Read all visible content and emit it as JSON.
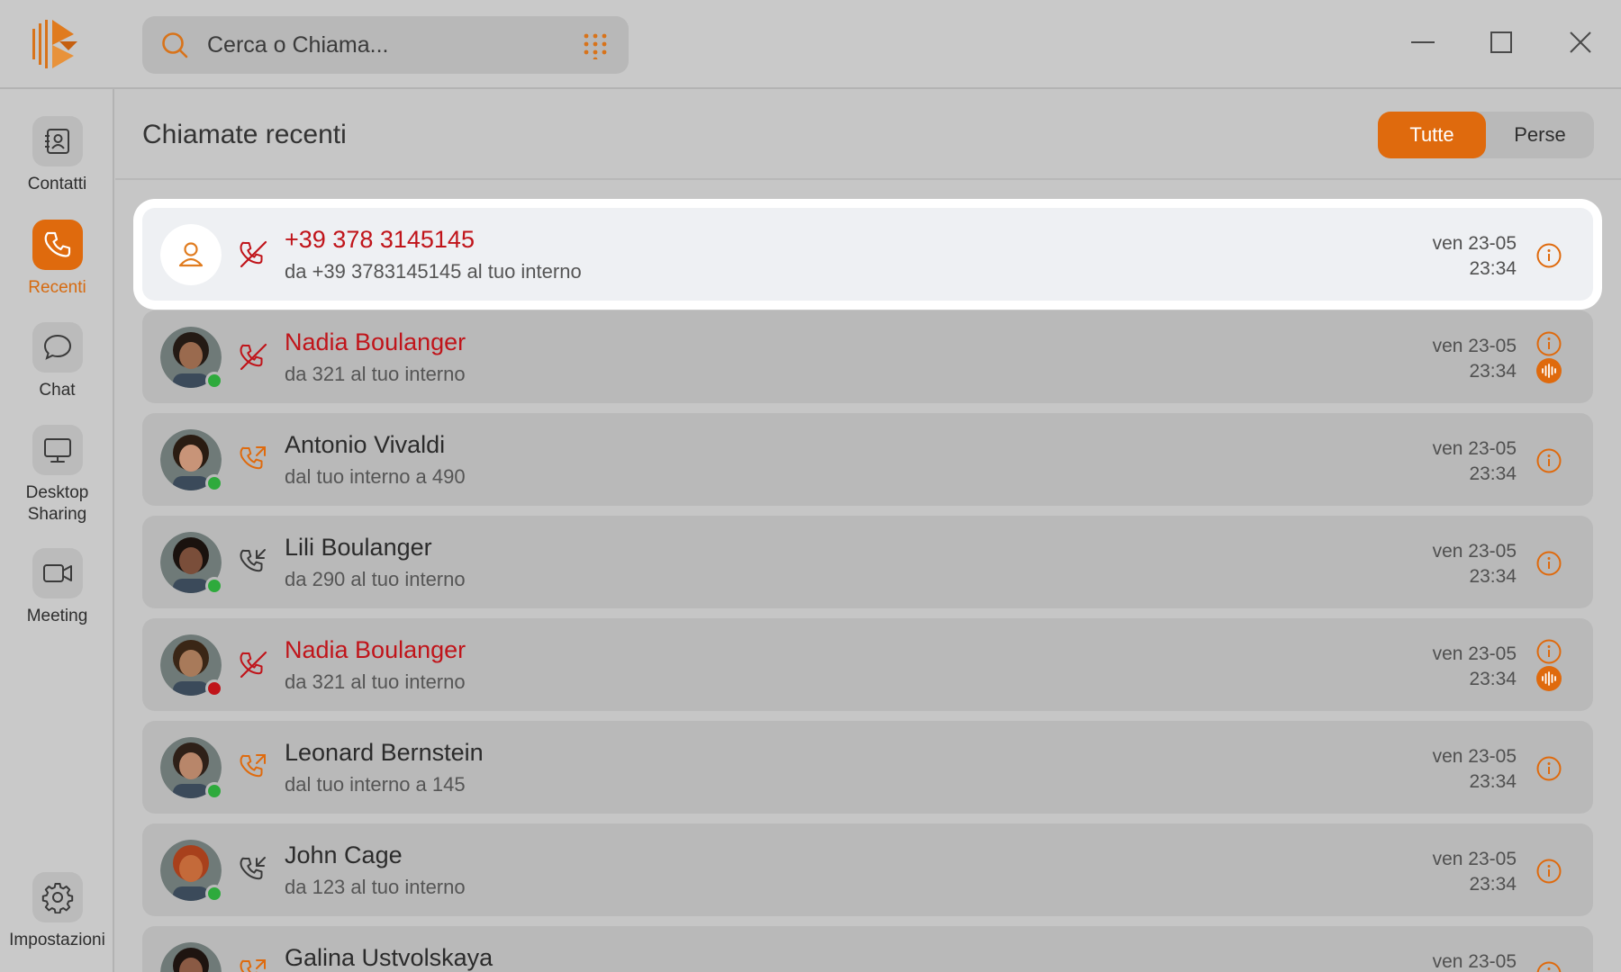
{
  "search": {
    "placeholder": "Cerca o Chiama..."
  },
  "sidebar": {
    "items": [
      {
        "label": "Contatti"
      },
      {
        "label": "Recenti"
      },
      {
        "label": "Chat"
      },
      {
        "label": "Desktop\nSharing"
      },
      {
        "label": "Meeting"
      },
      {
        "label": "Impostazioni"
      }
    ]
  },
  "main": {
    "title": "Chiamate recenti",
    "filter": {
      "all": "Tutte",
      "missed": "Perse",
      "selected": "Tutte"
    }
  },
  "calls": [
    {
      "name": "+39 378 3145145",
      "detail": "da +39 3783145145 al tuo interno",
      "date": "ven 23-05",
      "time": "23:34",
      "type": "missed",
      "status": "",
      "recording": false,
      "selected": true
    },
    {
      "name": "Nadia Boulanger",
      "detail": "da 321 al tuo interno",
      "date": "ven 23-05",
      "time": "23:34",
      "type": "missed",
      "status": "online",
      "recording": true,
      "selected": false
    },
    {
      "name": "Antonio Vivaldi",
      "detail": "dal tuo interno a 490",
      "date": "ven 23-05",
      "time": "23:34",
      "type": "outgoing",
      "status": "online",
      "recording": false,
      "selected": false
    },
    {
      "name": "Lili Boulanger",
      "detail": "da 290 al tuo interno",
      "date": "ven 23-05",
      "time": "23:34",
      "type": "incoming",
      "status": "online",
      "recording": false,
      "selected": false
    },
    {
      "name": "Nadia Boulanger",
      "detail": "da 321 al tuo interno",
      "date": "ven 23-05",
      "time": "23:34",
      "type": "missed",
      "status": "busy",
      "recording": true,
      "selected": false
    },
    {
      "name": "Leonard Bernstein",
      "detail": "dal tuo interno a 145",
      "date": "ven 23-05",
      "time": "23:34",
      "type": "outgoing",
      "status": "online",
      "recording": false,
      "selected": false
    },
    {
      "name": "John Cage",
      "detail": "da 123 al tuo interno",
      "date": "ven 23-05",
      "time": "23:34",
      "type": "incoming",
      "status": "online",
      "recording": false,
      "selected": false
    },
    {
      "name": "Galina Ustvolskaya",
      "detail": "",
      "date": "ven 23-05",
      "time": "",
      "type": "outgoing",
      "status": "",
      "recording": false,
      "selected": false
    }
  ],
  "colors": {
    "accent": "#df6a0d",
    "missed": "#c0141a",
    "online": "#2eaa3c",
    "busy": "#c0141a"
  },
  "icons": {
    "missed": "phone-missed-icon",
    "outgoing": "phone-outgoing-icon",
    "incoming": "phone-incoming-icon"
  }
}
